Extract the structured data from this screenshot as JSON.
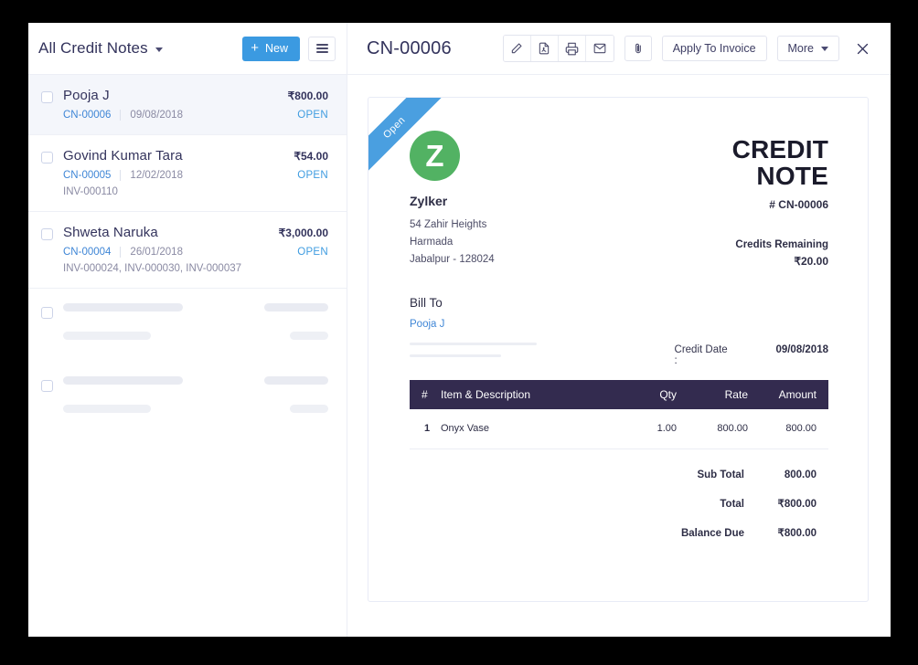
{
  "topbar": {
    "list_title": "All Credit Notes",
    "new_button": "New",
    "menu_icon": "hamburger-icon",
    "caret_icon": "chevron-down-icon",
    "doc_number": "CN-00006",
    "icons": [
      {
        "name": "edit-pencil-icon"
      },
      {
        "name": "pdf-file-icon"
      },
      {
        "name": "print-icon"
      },
      {
        "name": "email-icon"
      }
    ],
    "attachment_icon": "paperclip-icon",
    "apply_to_invoice": "Apply To Invoice",
    "more": "More",
    "close_icon": "close-icon"
  },
  "list": {
    "rows": [
      {
        "name": "Pooja J",
        "amount": "₹800.00",
        "cn": "CN-00006",
        "date": "09/08/2018",
        "status": "OPEN",
        "invoices": "",
        "selected": true
      },
      {
        "name": "Govind Kumar Tara",
        "amount": "₹54.00",
        "cn": "CN-00005",
        "date": "12/02/2018",
        "status": "OPEN",
        "invoices": "INV-000110",
        "selected": false
      },
      {
        "name": "Shweta Naruka",
        "amount": "₹3,000.00",
        "cn": "CN-00004",
        "date": "26/01/2018",
        "status": "OPEN",
        "invoices": "INV-000024, INV-000030, INV-000037",
        "selected": false
      }
    ],
    "skeleton_rows": 2
  },
  "document": {
    "ribbon": "Open",
    "logo_letter": "Z",
    "org_name": "Zylker",
    "org_address_line1": "54 Zahir Heights",
    "org_address_line2": "Harmada",
    "org_address_line3": "Jabalpur - 128024",
    "title": "CREDIT NOTE",
    "number": "# CN-00006",
    "credits_remaining_label": "Credits Remaining",
    "credits_remaining_value": "₹20.00",
    "bill_to_label": "Bill To",
    "bill_to_name": "Pooja J",
    "credit_date_label": "Credit Date :",
    "credit_date_value": "09/08/2018",
    "table": {
      "headers": {
        "index": "#",
        "item": "Item & Description",
        "qty": "Qty",
        "rate": "Rate",
        "amount": "Amount"
      },
      "rows": [
        {
          "index": "1",
          "item": "Onyx Vase",
          "qty": "1.00",
          "rate": "800.00",
          "amount": "800.00"
        }
      ]
    },
    "totals": [
      {
        "label": "Sub Total",
        "value": "800.00"
      },
      {
        "label": "Total",
        "value": "₹800.00"
      },
      {
        "label": "Balance Due",
        "value": "₹800.00"
      }
    ]
  },
  "colors": {
    "accent_blue": "#3b9ae1",
    "link_blue": "#3f86d6",
    "status_open": "#3f9ce0",
    "table_header": "#332b4f",
    "logo_green": "#52b263",
    "ribbon_blue": "#4a9fe0",
    "text_dark": "#33335c"
  }
}
